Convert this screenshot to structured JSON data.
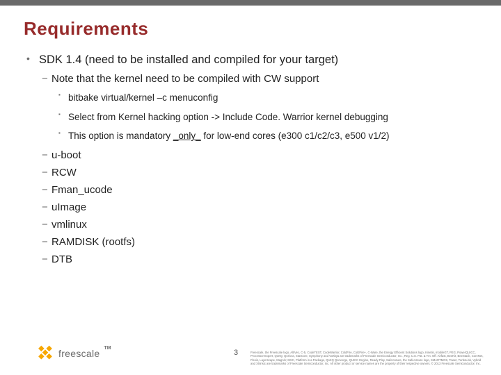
{
  "title": "Requirements",
  "b1_main": "SDK 1.4 (need to be installed and compiled for your target)",
  "b2_note": "Note that the kernel need to be compiled with CW support",
  "b3_a": "bitbake virtual/kernel –c menuconfig",
  "b3_b": "Select from Kernel hacking option -> Include Code. Warrior kernel debugging",
  "b3_c_pre": "This option is mandatory ",
  "b3_c_und": "_only_",
  "b3_c_post": " for low-end cores (e300 c1/c2/c3, e500 v1/2)",
  "b2_items": [
    "u-boot",
    "RCW",
    "Fman_ucode",
    "uImage",
    "vmlinux",
    "RAMDISK (rootfs)",
    "DTB"
  ],
  "page_number": "3",
  "logo_text": "freescale",
  "tm": "TM",
  "legal": "Freescale, the Freescale logo, AltiVec, C-5, CodeTEST, CodeWarrior, ColdFire, ColdFire+, C-Ware, the Energy Efficient Solutions logo, Kinetis, mobileGT, PEG, PowerQUICC, Processor Expert, QorIQ, Qorivva, StarCore, Symphony and VortiQa are trademarks of Freescale Semiconductor, Inc., Reg. U.S. Pat. & Tm. Off. Airfast, BeeKit, BeeStack, CoreNet, Flexis, Layerscape, MagniV, MXC, Platform in a Package, QorIQ Qonverge, QUICC Engine, Ready Play, SafeAssure, the SafeAssure logo, SMARTMOS, Tower, TurboLink, Vybrid and Xtrinsic are trademarks of Freescale Semiconductor, Inc. All other product or service names are the property of their respective owners. © 2013 Freescale Semiconductor, Inc."
}
